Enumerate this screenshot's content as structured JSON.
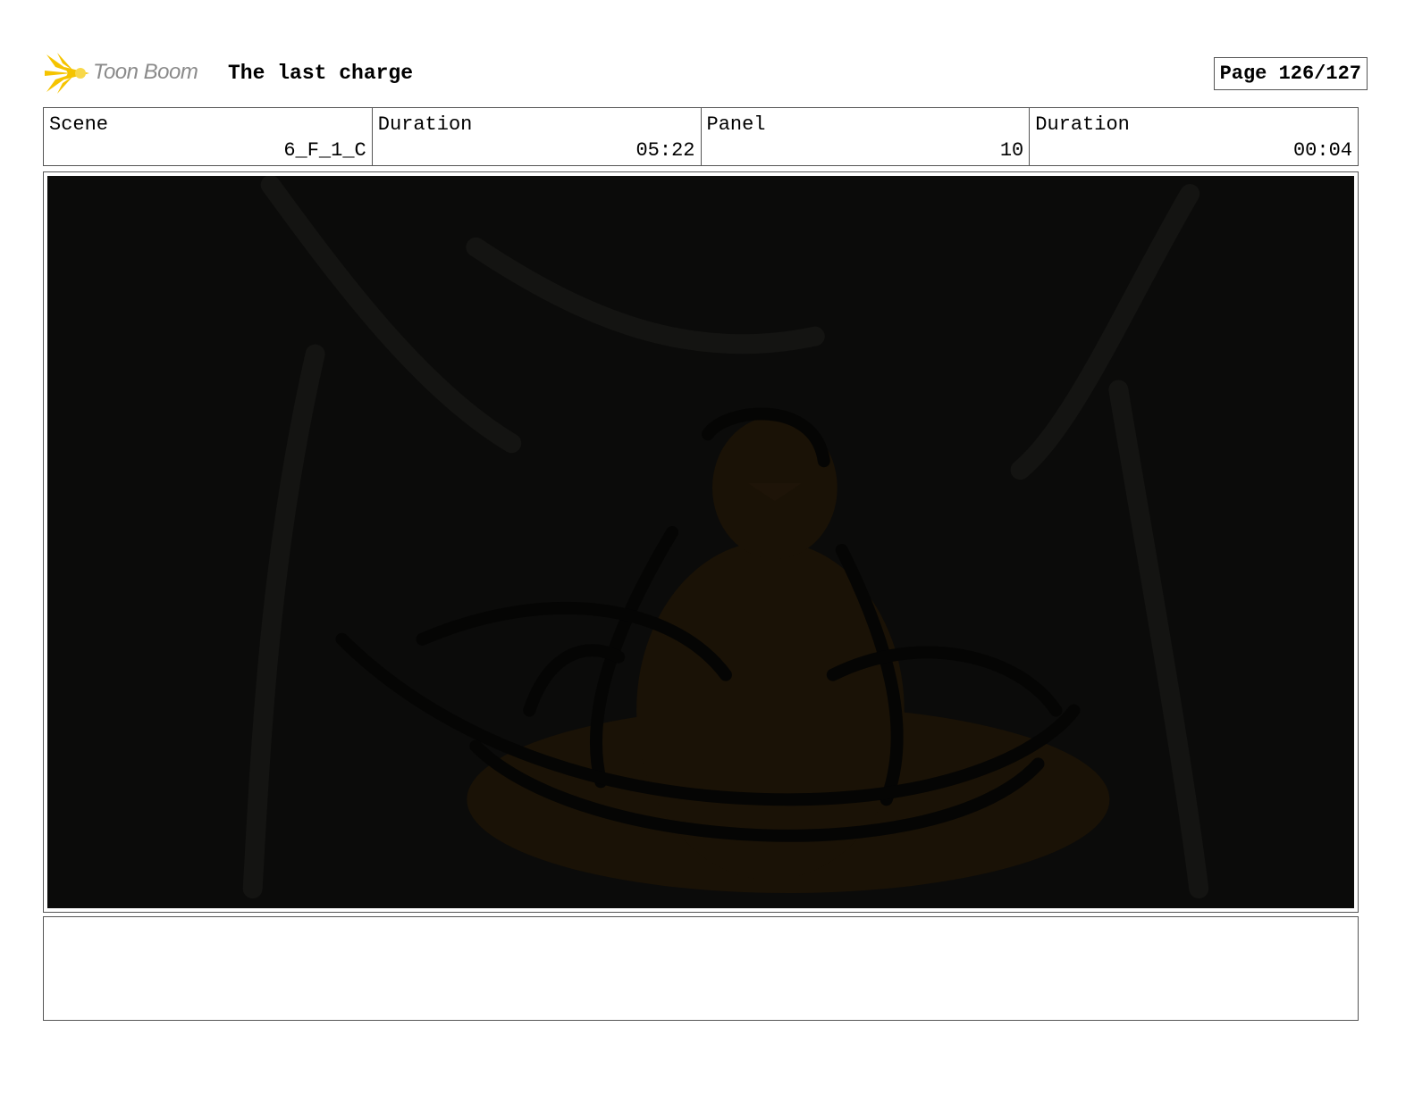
{
  "header": {
    "logo_text": "Toon Boom",
    "title": "The last charge",
    "page": "Page 126/127"
  },
  "info": [
    {
      "label": "Scene",
      "value": "6_F_1_C"
    },
    {
      "label": "Duration",
      "value": "05:22"
    },
    {
      "label": "Panel",
      "value": "10"
    },
    {
      "label": "Duration",
      "value": "00:04"
    }
  ],
  "panel": {
    "icon": "storyboard-sketch-image",
    "background": "#0b0b0a",
    "accent": "#2a1a06"
  },
  "notes": {
    "text": ""
  },
  "colors": {
    "logo_yellow": "#f5c400",
    "logo_gray": "#8a8a8a"
  }
}
